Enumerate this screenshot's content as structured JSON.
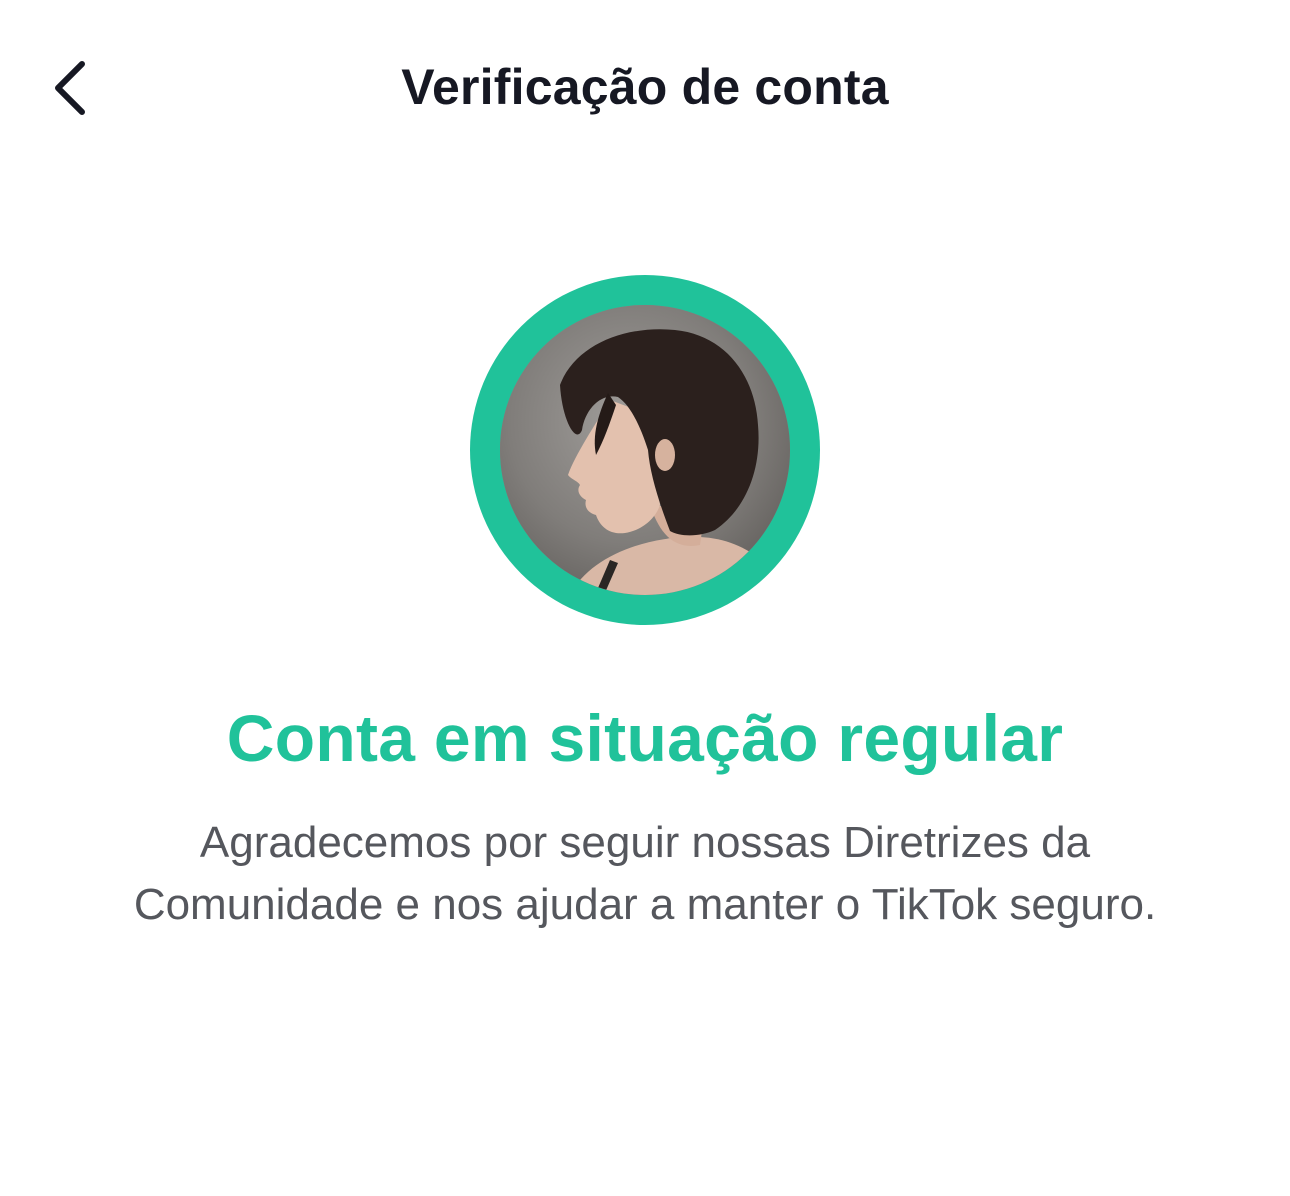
{
  "header": {
    "title": "Verificação de conta",
    "back_icon": "chevron-left-icon"
  },
  "profile": {
    "ring_color": "#20c29a",
    "status_color": "#20c29a"
  },
  "status": {
    "title": "Conta em situação regular",
    "description": "Agradecemos por seguir nossas Diretrizes da Comunidade e nos ajudar a manter o TikTok seguro."
  }
}
